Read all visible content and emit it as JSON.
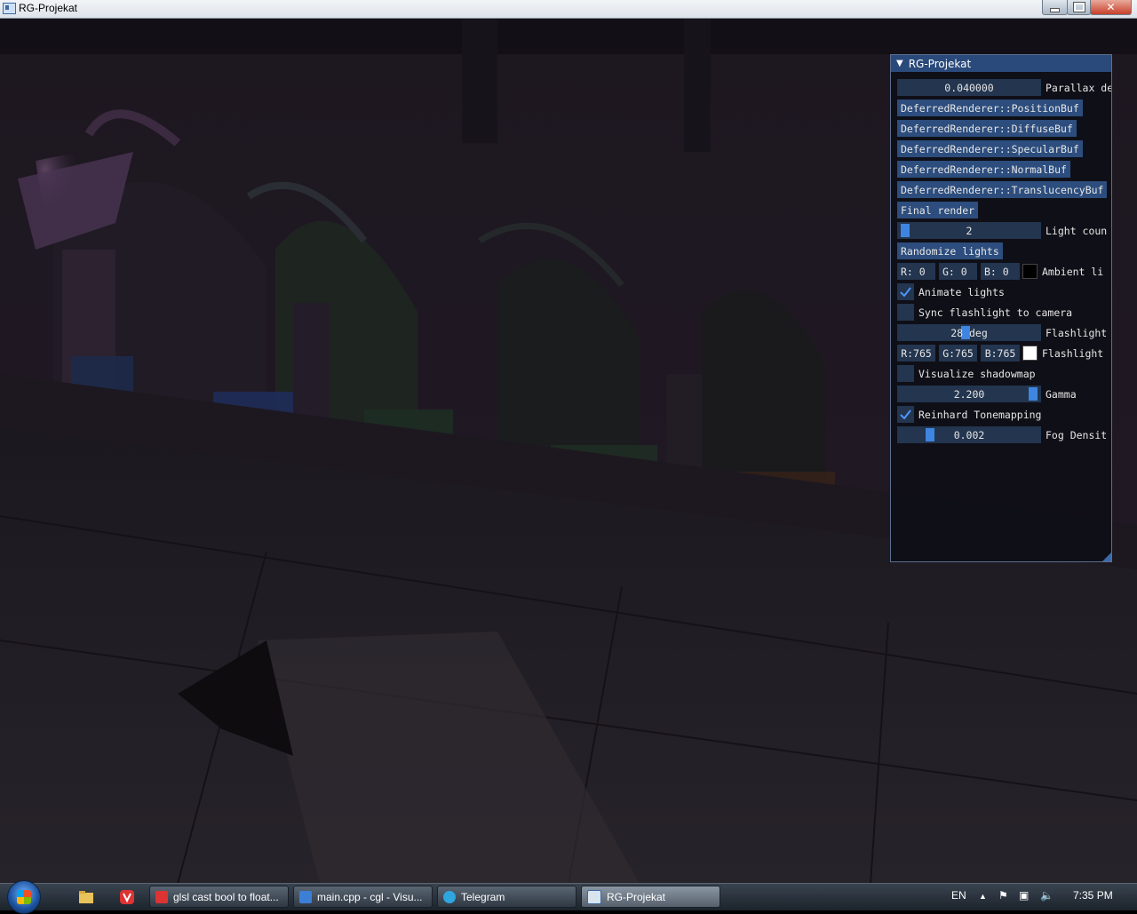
{
  "window": {
    "title": "RG-Projekat",
    "close_glyph": "✕"
  },
  "panel": {
    "title": "RG-Projekat",
    "parallax_value": "0.040000",
    "parallax_label": "Parallax de",
    "buffer_buttons": [
      "DeferredRenderer::PositionBuf",
      "DeferredRenderer::DiffuseBuf",
      "DeferredRenderer::SpecularBuf",
      "DeferredRenderer::NormalBuf",
      "DeferredRenderer::TranslucencyBuf"
    ],
    "final_render": "Final render",
    "light_count_value": "2",
    "light_count_label": "Light coun",
    "randomize_lights": "Randomize lights",
    "ambient": {
      "r": "R:  0",
      "g": "G:  0",
      "b": "B:  0",
      "label": "Ambient li",
      "swatch": "#000000"
    },
    "animate_lights": {
      "label": "Animate lights",
      "checked": true
    },
    "sync_flashlight": {
      "label": "Sync flashlight to camera",
      "checked": false
    },
    "flashlight_angle_value": "28 deg",
    "flashlight_angle_label": "Flashlight",
    "flashlight_color": {
      "r": "R:765",
      "g": "G:765",
      "b": "B:765",
      "label": "Flashlight",
      "swatch": "#ffffff"
    },
    "visualize_shadowmap": {
      "label": "Visualize shadowmap",
      "checked": false
    },
    "gamma_value": "2.200",
    "gamma_label": "Gamma",
    "reinhard": {
      "label": "Reinhard Tonemapping",
      "checked": true
    },
    "fog_value": "0.002",
    "fog_label": "Fog Densit"
  },
  "taskbar": {
    "items": [
      {
        "label": "glsl cast bool to float...",
        "icon": "vivaldi-icon",
        "color": "#d33"
      },
      {
        "label": "main.cpp - cgl - Visu...",
        "icon": "visual-studio-icon",
        "color": "#3b7fd6"
      },
      {
        "label": "Telegram",
        "icon": "telegram-icon",
        "color": "#2ea6e0"
      },
      {
        "label": "RG-Projekat",
        "icon": "app-window-icon",
        "color": "#d9e4ee"
      }
    ],
    "language": "EN",
    "time": "7:35 PM"
  },
  "colors": {
    "accent": "#3d85e0",
    "panel_header": "#294a7a",
    "button": "#2c4d7d",
    "frame_bg": "#23354f"
  }
}
